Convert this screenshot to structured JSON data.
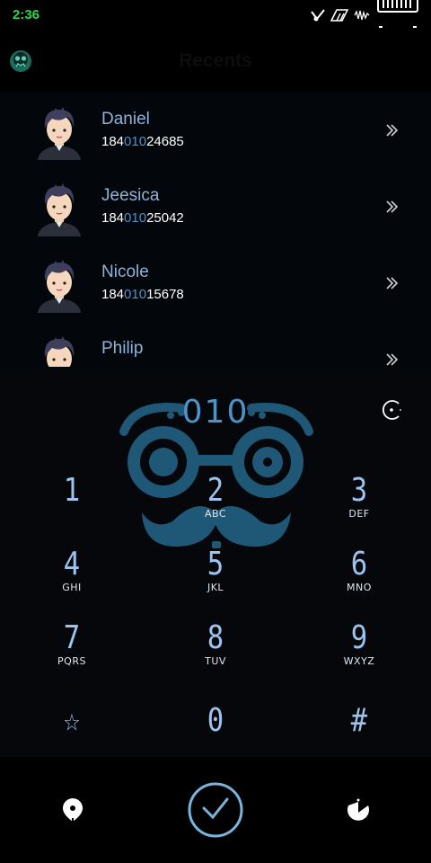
{
  "status_bar": {
    "time": "2:36",
    "icons": [
      "vibration-icon",
      "signal-icon",
      "wave-icon",
      "battery-icon"
    ]
  },
  "header": {
    "title": "Recents",
    "app_icon": "skull-logo-icon"
  },
  "contacts": [
    {
      "name": "Daniel",
      "number_pre": "184",
      "number_match": "010",
      "number_post": "24685"
    },
    {
      "name": "Jeesica",
      "number_pre": "184",
      "number_match": "010",
      "number_post": "25042"
    },
    {
      "name": "Nicole",
      "number_pre": "184",
      "number_match": "010",
      "number_post": "15678"
    },
    {
      "name": "Philip",
      "number_pre": "",
      "number_match": "",
      "number_post": ""
    }
  ],
  "dialer": {
    "input_value": "010",
    "keys": [
      {
        "digit": "1",
        "letters": ""
      },
      {
        "digit": "2",
        "letters": "ABC"
      },
      {
        "digit": "3",
        "letters": "DEF"
      },
      {
        "digit": "4",
        "letters": "GHI"
      },
      {
        "digit": "5",
        "letters": "JKL"
      },
      {
        "digit": "6",
        "letters": "MNO"
      },
      {
        "digit": "7",
        "letters": "PQRS"
      },
      {
        "digit": "8",
        "letters": "TUV"
      },
      {
        "digit": "9",
        "letters": "WXYZ"
      },
      {
        "digit": "☆",
        "letters": ""
      },
      {
        "digit": "0",
        "letters": ""
      },
      {
        "digit": "#",
        "letters": ""
      }
    ]
  },
  "bottom_bar": {
    "left_icon": "location-pin-icon",
    "center_icon": "call-check-icon",
    "right_icon": "pacman-icon"
  },
  "colors": {
    "accent": "#4e93c7",
    "name": "#8fb3d6",
    "status_time": "#27d64a",
    "mascot": "#1f5777"
  }
}
